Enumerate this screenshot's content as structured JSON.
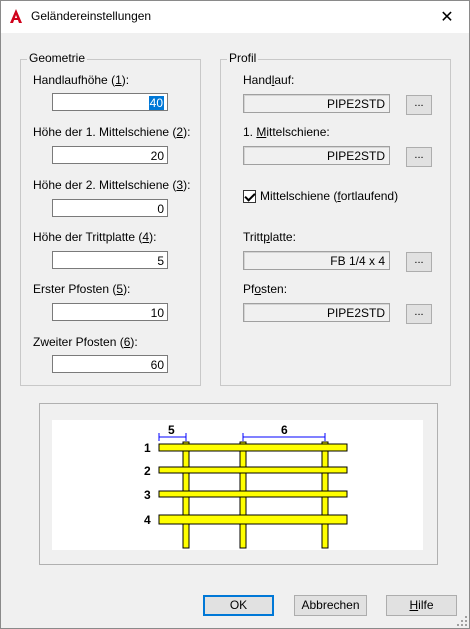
{
  "window": {
    "title": "Geländereinstellungen"
  },
  "geometry": {
    "group_label": "Geometrie",
    "fields": [
      {
        "label_pre": "Handlaufhöhe (",
        "key": "1",
        "label_post": "):",
        "value": "40"
      },
      {
        "label_pre": "Höhe der 1. Mittelschiene (",
        "key": "2",
        "label_post": "):",
        "value": "20"
      },
      {
        "label_pre": "Höhe der 2. Mittelschiene (",
        "key": "3",
        "label_post": "):",
        "value": "0"
      },
      {
        "label_pre": "Höhe der Trittplatte (",
        "key": "4",
        "label_post": "):",
        "value": "5"
      },
      {
        "label_pre": "Erster Pfosten (",
        "key": "5",
        "label_post": "):",
        "value": "10"
      },
      {
        "label_pre": "Zweiter Pfosten (",
        "key": "6",
        "label_post": "):",
        "value": "60"
      }
    ]
  },
  "profile": {
    "group_label": "Profil",
    "handrail": {
      "label_pre": "Hand",
      "key": "l",
      "label_post": "auf:",
      "value": "PIPE2STD"
    },
    "midrail": {
      "label_pre": "1. ",
      "key": "M",
      "label_post": "ittelschiene:",
      "value": "PIPE2STD"
    },
    "continuous": {
      "label_pre": "Mittelschiene (",
      "key": "f",
      "label_post": "ortlaufend)",
      "checked": true
    },
    "toeplate": {
      "label_pre": "Tritt",
      "key": "p",
      "label_post": "latte:",
      "value": "FB 1/4 x 4"
    },
    "post": {
      "label_pre": "Pf",
      "key": "o",
      "label_post": "sten:",
      "value": "PIPE2STD"
    },
    "browse_label": "..."
  },
  "preview": {
    "rail_numbers": [
      "1",
      "2",
      "3",
      "4"
    ],
    "dim_first_post": "5",
    "dim_second_post": "6",
    "rail_color": "#ffff00"
  },
  "buttons": {
    "ok": "OK",
    "cancel": "Abbrechen",
    "help_key": "H",
    "help_rest": "ilfe"
  },
  "colors": {
    "app_icon": "#d0021b",
    "focus": "#0078d7"
  }
}
